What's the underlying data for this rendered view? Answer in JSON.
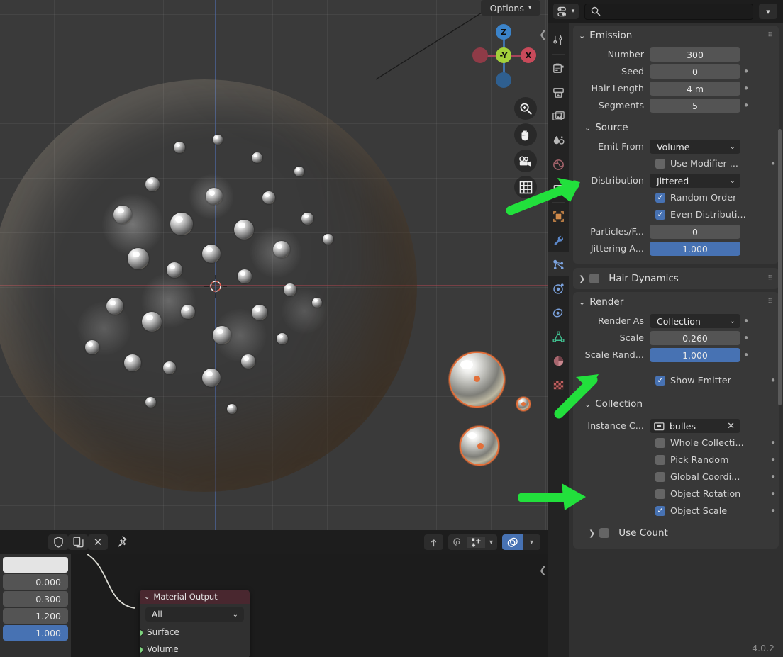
{
  "app": {
    "version": "4.0.2"
  },
  "viewport": {
    "options_label": "Options",
    "gizmo": {
      "z": "Z",
      "x": "X",
      "center": "-Y"
    },
    "tools": [
      "zoom-icon",
      "hand-icon",
      "camera-icon",
      "grid-icon"
    ],
    "collapse_icon": "chevron-left-icon"
  },
  "properties": {
    "header": {
      "editor_type_icon": "properties-editor-icon",
      "search_placeholder": "",
      "search_value": "",
      "filter_icon": "chevron-down-icon"
    },
    "tabs": [
      {
        "name": "tool",
        "icon": "tool-icon",
        "active": false
      },
      {
        "name": "render",
        "icon": "render-camera-icon",
        "active": false
      },
      {
        "name": "output",
        "icon": "printer-icon",
        "active": false
      },
      {
        "name": "view-layer",
        "icon": "images-icon",
        "active": false
      },
      {
        "name": "scene",
        "icon": "scene-cone-icon",
        "active": false
      },
      {
        "name": "world",
        "icon": "world-globe-icon",
        "active": false
      },
      {
        "name": "collection",
        "icon": "collection-box-icon",
        "active": false
      },
      {
        "name": "object",
        "icon": "object-square-icon",
        "active": false
      },
      {
        "name": "modifiers",
        "icon": "wrench-icon",
        "active": false
      },
      {
        "name": "particles",
        "icon": "particles-icon",
        "active": true
      },
      {
        "name": "physics",
        "icon": "physics-orbit-icon",
        "active": false
      },
      {
        "name": "constraints",
        "icon": "constraints-icon",
        "active": false
      },
      {
        "name": "data",
        "icon": "mesh-data-icon",
        "active": false
      },
      {
        "name": "material",
        "icon": "material-sphere-icon",
        "active": false
      },
      {
        "name": "texture",
        "icon": "texture-checker-icon",
        "active": false
      }
    ],
    "emission": {
      "title": "Emission",
      "fields": [
        {
          "label": "Number",
          "value": "300",
          "animatable": false
        },
        {
          "label": "Seed",
          "value": "0",
          "animatable": true
        },
        {
          "label": "Hair Length",
          "value": "4 m",
          "animatable": true
        },
        {
          "label": "Segments",
          "value": "5",
          "animatable": true
        }
      ],
      "source": {
        "title": "Source",
        "emit_from": {
          "label": "Emit From",
          "value": "Volume"
        },
        "use_modifier": {
          "label": "Use Modifier ...",
          "checked": false,
          "animatable": true
        },
        "distribution": {
          "label": "Distribution",
          "value": "Jittered"
        },
        "random_order": {
          "label": "Random Order",
          "checked": true
        },
        "even_distribution": {
          "label": "Even Distributi...",
          "checked": true
        },
        "particles_face": {
          "label": "Particles/F...",
          "value": "0"
        },
        "jittering": {
          "label": "Jittering A...",
          "value": "1.000",
          "fill_pct": 100
        }
      }
    },
    "hair_dynamics": {
      "title": "Hair Dynamics",
      "checked": false,
      "expanded": false
    },
    "render": {
      "title": "Render",
      "render_as": {
        "label": "Render As",
        "value": "Collection",
        "animatable": true
      },
      "scale": {
        "label": "Scale",
        "value": "0.260",
        "animatable": true
      },
      "scale_randomness": {
        "label": "Scale Rand...",
        "value": "1.000",
        "fill_pct": 100,
        "animatable": true
      },
      "show_emitter": {
        "label": "Show Emitter",
        "checked": true,
        "animatable": true
      },
      "collection": {
        "title": "Collection",
        "instance_collection": {
          "label": "Instance C...",
          "value": "bulles",
          "icon": "collection-icon",
          "clear_icon": "x-icon"
        },
        "options": [
          {
            "label": "Whole Collecti...",
            "checked": false,
            "animatable": true
          },
          {
            "label": "Pick Random",
            "checked": false,
            "animatable": true
          },
          {
            "label": "Global Coordi...",
            "checked": false,
            "animatable": true
          },
          {
            "label": "Object Rotation",
            "checked": false,
            "animatable": true
          },
          {
            "label": "Object Scale",
            "checked": true,
            "animatable": true
          }
        ],
        "use_count": {
          "label": "Use Count",
          "checked": false,
          "expanded": false
        }
      }
    }
  },
  "node_editor": {
    "header_buttons": [
      "shield-icon",
      "copy-icon",
      "x-icon",
      "pin-icon"
    ],
    "right_buttons": [
      "snap-parent-icon",
      "proportional-icon",
      "snap-magnet-icon",
      "snap-grid-icon",
      "chevron-down-icon",
      "overlay-sphere-icon",
      "chevron-down-icon-2"
    ],
    "sidebar_values": [
      "",
      "0.000",
      "0.300",
      "1.200",
      "1.000"
    ],
    "node": {
      "title": "Material Output",
      "target": "All",
      "inputs": [
        "Surface",
        "Volume"
      ]
    }
  },
  "annotations": {
    "arrows": [
      {
        "name": "arrow-to-particles-tab",
        "direction": "up-right"
      },
      {
        "name": "arrow-to-render-as",
        "direction": "up-right"
      },
      {
        "name": "arrow-to-instance-collection",
        "direction": "right"
      }
    ],
    "color": "#22e03c"
  }
}
